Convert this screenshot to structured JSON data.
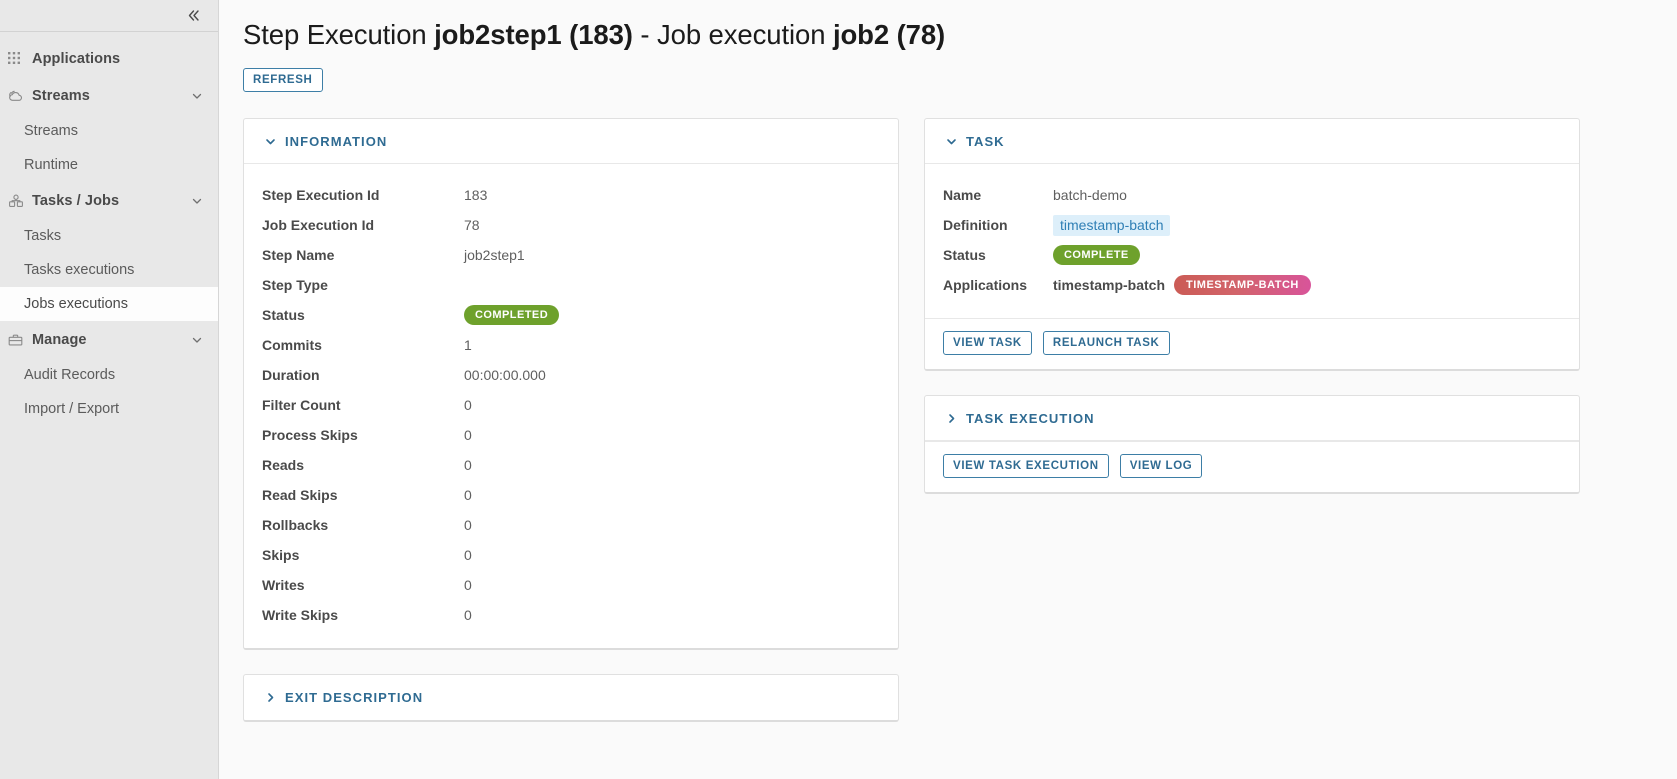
{
  "sidebar": {
    "collapse_icon": "chevron-double-left-icon",
    "groups": [
      {
        "id": "applications",
        "label": "Applications",
        "icon": "grid-dots-icon",
        "has_chevron": false,
        "items": []
      },
      {
        "id": "streams",
        "label": "Streams",
        "icon": "cloud-stream-icon",
        "has_chevron": true,
        "chevron": "chevron-down-icon",
        "items": [
          {
            "id": "streams",
            "label": "Streams",
            "active": false
          },
          {
            "id": "runtime",
            "label": "Runtime",
            "active": false
          }
        ]
      },
      {
        "id": "tasks-jobs",
        "label": "Tasks / Jobs",
        "icon": "tasks-jobs-icon",
        "has_chevron": true,
        "chevron": "chevron-down-icon",
        "items": [
          {
            "id": "tasks",
            "label": "Tasks",
            "active": false
          },
          {
            "id": "tasks-executions",
            "label": "Tasks executions",
            "active": false
          },
          {
            "id": "jobs-executions",
            "label": "Jobs executions",
            "active": true
          }
        ]
      },
      {
        "id": "manage",
        "label": "Manage",
        "icon": "briefcase-icon",
        "has_chevron": true,
        "chevron": "chevron-down-icon",
        "items": [
          {
            "id": "audit-records",
            "label": "Audit Records",
            "active": false
          },
          {
            "id": "import-export",
            "label": "Import / Export",
            "active": false
          }
        ]
      }
    ]
  },
  "page": {
    "title_prefix": "Step Execution ",
    "title_step": "job2step1 (183)",
    "title_middle": " - Job execution ",
    "title_job": "job2 (78)",
    "refresh_label": "Refresh"
  },
  "information": {
    "header": "Information",
    "caret_icon": "chevron-down-icon",
    "rows": [
      {
        "label": "Step Execution Id",
        "value": "183",
        "type": "text"
      },
      {
        "label": "Job Execution Id",
        "value": "78",
        "type": "text"
      },
      {
        "label": "Step Name",
        "value": "job2step1",
        "type": "text"
      },
      {
        "label": "Step Type",
        "value": "",
        "type": "text"
      },
      {
        "label": "Status",
        "value": "COMPLETED",
        "type": "badge-green"
      },
      {
        "label": "Commits",
        "value": "1",
        "type": "text"
      },
      {
        "label": "Duration",
        "value": "00:00:00.000",
        "type": "text"
      },
      {
        "label": "Filter Count",
        "value": "0",
        "type": "text"
      },
      {
        "label": "Process Skips",
        "value": "0",
        "type": "text"
      },
      {
        "label": "Reads",
        "value": "0",
        "type": "text"
      },
      {
        "label": "Read Skips",
        "value": "0",
        "type": "text"
      },
      {
        "label": "Rollbacks",
        "value": "0",
        "type": "text"
      },
      {
        "label": "Skips",
        "value": "0",
        "type": "text"
      },
      {
        "label": "Writes",
        "value": "0",
        "type": "text"
      },
      {
        "label": "Write Skips",
        "value": "0",
        "type": "text"
      }
    ]
  },
  "exit_description": {
    "header": "Exit Description",
    "caret_icon": "chevron-right-icon"
  },
  "task": {
    "header": "Task",
    "caret_icon": "chevron-down-icon",
    "name_label": "Name",
    "name_value": "batch-demo",
    "definition_label": "Definition",
    "definition_value": "timestamp-batch",
    "status_label": "Status",
    "status_value": "COMPLETE",
    "applications_label": "Applications",
    "applications_value": "timestamp-batch",
    "applications_badge": "timestamp-batch",
    "view_task_label": "View Task",
    "relaunch_task_label": "Relaunch Task"
  },
  "task_execution": {
    "header": "Task Execution",
    "caret_icon": "chevron-right-icon",
    "view_task_execution_label": "View Task Execution",
    "view_log_label": "View Log"
  },
  "colors": {
    "accent": "#2f6b92",
    "status_green": "#6ea12c",
    "badge_gradient_start": "#cb5b55",
    "badge_gradient_end": "#d8549a",
    "chip_bg": "#ddeffa",
    "sidebar_bg": "#e8e8e8"
  }
}
